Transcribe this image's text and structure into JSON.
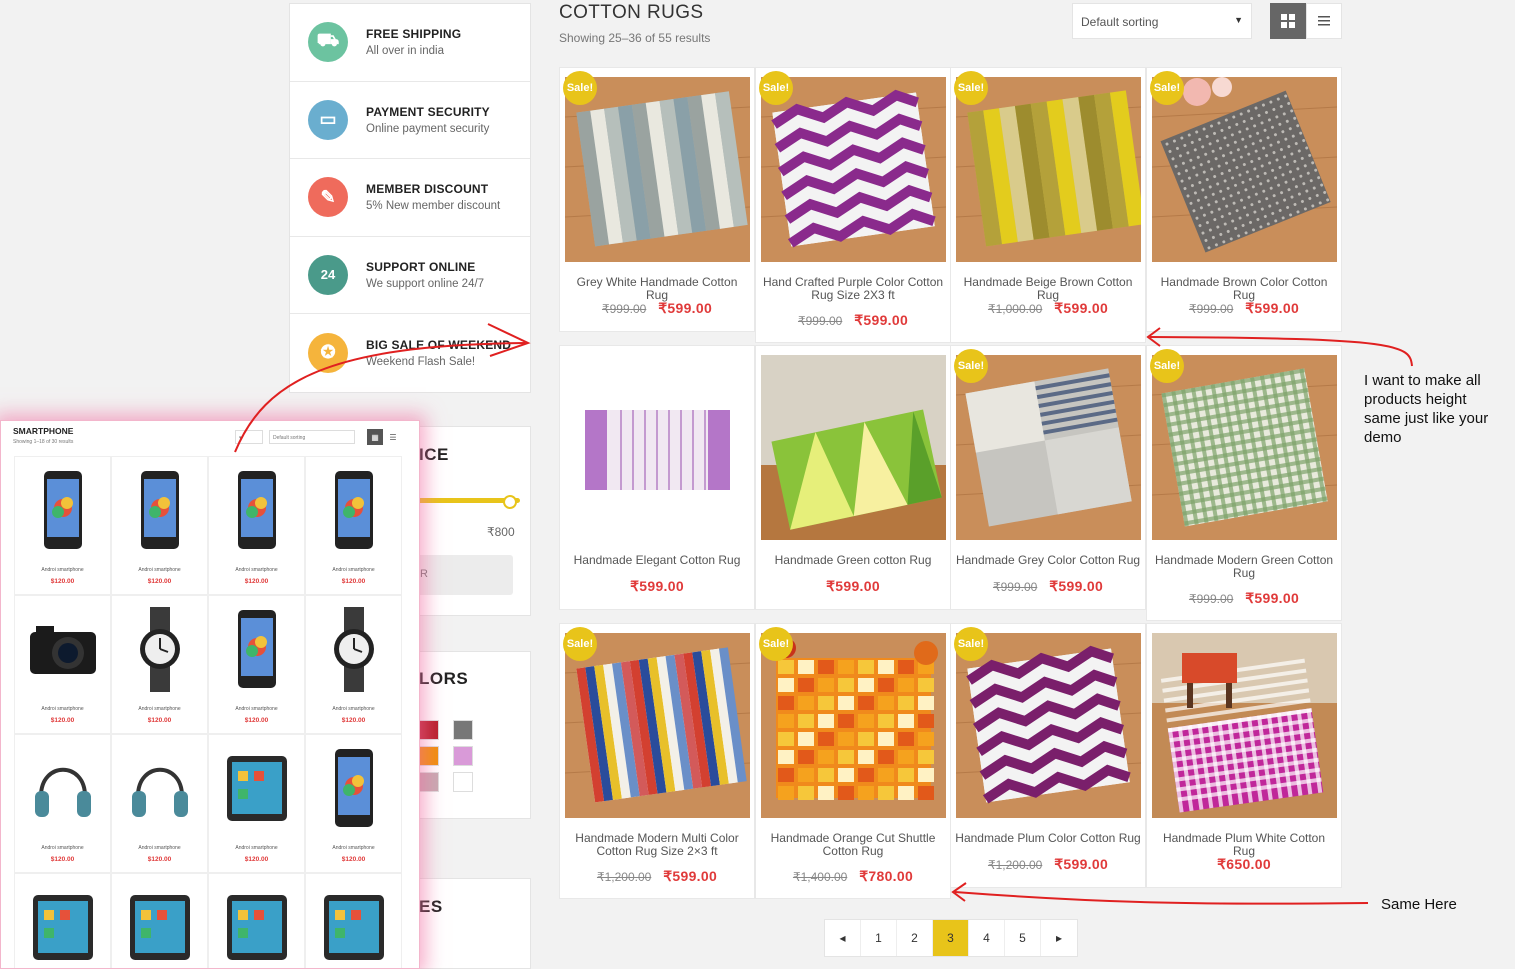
{
  "features": [
    {
      "title": "FREE SHIPPING",
      "subtitle": "All over in india",
      "color": "#6cc3a0",
      "icon": "truck-icon",
      "glyph": "⛟"
    },
    {
      "title": "PAYMENT SECURITY",
      "subtitle": "Online payment security",
      "color": "#6aaecf",
      "icon": "credit-card-icon",
      "glyph": "▭"
    },
    {
      "title": "MEMBER DISCOUNT",
      "subtitle": "5% New member discount",
      "color": "#ef6b5c",
      "icon": "tag-icon",
      "glyph": "✎"
    },
    {
      "title": "SUPPORT ONLINE",
      "subtitle": "We support online 24/7",
      "color": "#4a9a8a",
      "icon": "support-24-icon",
      "glyph": "24"
    },
    {
      "title": "BIG SALE OF WEEKEND",
      "subtitle": "Weekend Flash Sale!",
      "color": "#f5b43c",
      "icon": "badge-icon",
      "glyph": "✪"
    }
  ],
  "sidebar": {
    "price_widget_title_fragment": "ICE",
    "price_max": "₹800",
    "filter_button_fragment": "R",
    "colors_widget_title_fragment": "LORS",
    "sizes_widget_title_fragment": "ES",
    "swatch_colors": [
      "#b8202c",
      "#777777",
      "#f0900c",
      "#d99ad8",
      "#c8aab2",
      "#ffffff"
    ]
  },
  "header": {
    "title": "COTTON RUGS",
    "result_count": "Showing 25–36 of 55 results",
    "sort_value": "Default sorting"
  },
  "sale_label": "Sale!",
  "products": [
    {
      "name": "Grey White Handmade Cotton Rug",
      "old_price": "₹999.00",
      "price": "₹599.00",
      "sale": true,
      "pattern": "stripes-grey"
    },
    {
      "name": "Hand Crafted Purple Color Cotton Rug Size 2X3 ft",
      "old_price": "₹999.00",
      "price": "₹599.00",
      "sale": true,
      "pattern": "chevron-purple"
    },
    {
      "name": "Handmade Beige Brown Cotton Rug",
      "old_price": "₹1,000.00",
      "price": "₹599.00",
      "sale": true,
      "pattern": "stripes-yellow"
    },
    {
      "name": "Handmade Brown Color Cotton Rug",
      "old_price": "₹999.00",
      "price": "₹599.00",
      "sale": true,
      "pattern": "dots-grey"
    },
    {
      "name": "Handmade Elegant Cotton Rug",
      "old_price": "",
      "price": "₹599.00",
      "sale": false,
      "pattern": "elegant-pink"
    },
    {
      "name": "Handmade Green cotton Rug",
      "old_price": "",
      "price": "₹599.00",
      "sale": false,
      "pattern": "triangles-green"
    },
    {
      "name": "Handmade Grey Color Cotton Rug",
      "old_price": "₹999.00",
      "price": "₹599.00",
      "sale": true,
      "pattern": "blocks-grey"
    },
    {
      "name": "Handmade Modern Green Cotton Rug",
      "old_price": "₹999.00",
      "price": "₹599.00",
      "sale": true,
      "pattern": "check-green"
    },
    {
      "name": "Handmade Modern Multi Color Cotton Rug Size 2×3 ft",
      "old_price": "₹1,200.00",
      "price": "₹599.00",
      "sale": true,
      "pattern": "stripes-multi"
    },
    {
      "name": "Handmade Orange Cut Shuttle Cotton Rug",
      "old_price": "₹1,400.00",
      "price": "₹780.00",
      "sale": true,
      "pattern": "orange-blocks"
    },
    {
      "name": "Handmade Plum Color Cotton Rug",
      "old_price": "₹1,200.00",
      "price": "₹599.00",
      "sale": true,
      "pattern": "chevron-plum"
    },
    {
      "name": "Handmade Plum White Cotton Rug",
      "old_price": "",
      "price": "₹650.00",
      "sale": false,
      "pattern": "check-magenta"
    }
  ],
  "pagination": {
    "prev": "◂",
    "pages": [
      "1",
      "2",
      "3",
      "4",
      "5"
    ],
    "current": "3",
    "next": "▸"
  },
  "annotations": {
    "note_1": "I want to make all products height same just like your demo",
    "note_2": "Same Here",
    "color": "#e02020"
  },
  "inset": {
    "title": "SMARTPHONE",
    "result_count": "Showing 1–18 of 30 results",
    "sort_value": "Default sorting",
    "items": [
      {
        "name": "Androi smartphone",
        "price": "$120.00",
        "kind": "phone"
      },
      {
        "name": "Androi smartphone",
        "price": "$120.00",
        "kind": "phone"
      },
      {
        "name": "Androi smartphone",
        "price": "$120.00",
        "kind": "phone"
      },
      {
        "name": "Androi smartphone",
        "price": "$120.00",
        "kind": "phone"
      },
      {
        "name": "Androi smartphone",
        "price": "$120.00",
        "kind": "camera"
      },
      {
        "name": "Androi smartphone",
        "price": "$120.00",
        "kind": "watch"
      },
      {
        "name": "Androi smartphone",
        "price": "$120.00",
        "kind": "phone"
      },
      {
        "name": "Androi smartphone",
        "price": "$120.00",
        "kind": "watch"
      },
      {
        "name": "Androi smartphone",
        "price": "$120.00",
        "kind": "headphones"
      },
      {
        "name": "Androi smartphone",
        "price": "$120.00",
        "kind": "headphones"
      },
      {
        "name": "Androi smartphone",
        "price": "$120.00",
        "kind": "tablet"
      },
      {
        "name": "Androi smartphone",
        "price": "$120.00",
        "kind": "phone"
      },
      {
        "name": "",
        "price": "",
        "kind": "tablet"
      },
      {
        "name": "",
        "price": "",
        "kind": "tablet"
      },
      {
        "name": "",
        "price": "",
        "kind": "tablet"
      },
      {
        "name": "",
        "price": "",
        "kind": "tablet"
      }
    ]
  }
}
